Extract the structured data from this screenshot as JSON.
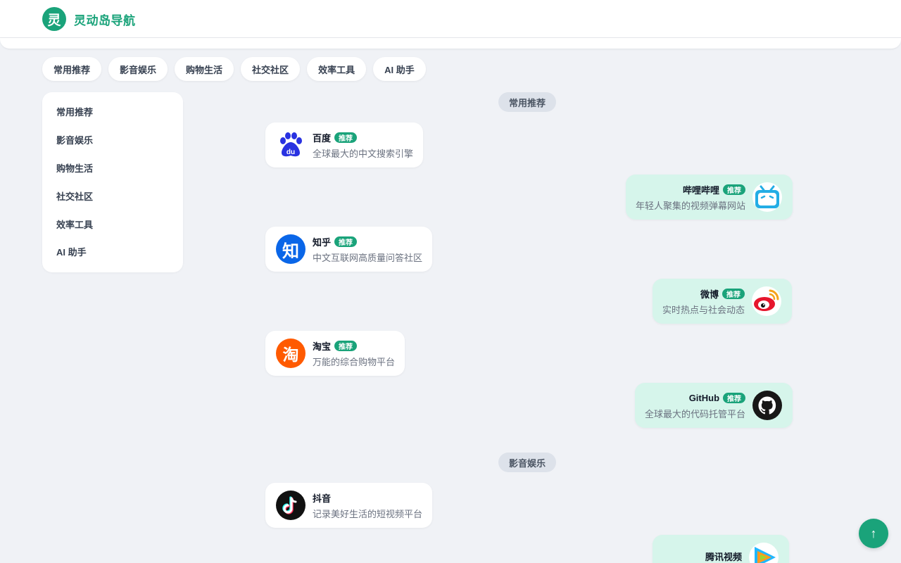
{
  "brand": {
    "logo_char": "灵",
    "title": "灵动岛导航",
    "accent": "#1aa37a"
  },
  "chips": [
    "常用推荐",
    "影音娱乐",
    "购物生活",
    "社交社区",
    "效率工具",
    "AI 助手"
  ],
  "sidebar": [
    "常用推荐",
    "影音娱乐",
    "购物生活",
    "社交社区",
    "效率工具",
    "AI 助手"
  ],
  "sections": [
    {
      "title": "常用推荐",
      "sites": [
        {
          "name": "百度",
          "badge": "推荐",
          "desc": "全球最大的中文搜索引擎",
          "icon": "baidu-paw-icon"
        },
        {
          "name": "哔哩哔哩",
          "badge": "推荐",
          "desc": "年轻人聚集的视频弹幕网站",
          "icon": "bilibili-tv-icon"
        },
        {
          "name": "知乎",
          "badge": "推荐",
          "desc": "中文互联网高质量问答社区",
          "icon": "zhihu-icon"
        },
        {
          "name": "微博",
          "badge": "推荐",
          "desc": "实时热点与社会动态",
          "icon": "weibo-eye-icon"
        },
        {
          "name": "淘宝",
          "badge": "推荐",
          "desc": "万能的综合购物平台",
          "icon": "taobao-icon"
        },
        {
          "name": "GitHub",
          "badge": "推荐",
          "desc": "全球最大的代码托管平台",
          "icon": "github-octocat-icon"
        }
      ]
    },
    {
      "title": "影音娱乐",
      "sites": [
        {
          "name": "抖音",
          "desc": "记录美好生活的短视频平台",
          "icon": "douyin-note-icon"
        },
        {
          "name": "腾讯视频",
          "desc": "",
          "icon": "tencent-video-play-icon"
        }
      ]
    }
  ],
  "back_to_top": "↑",
  "icon_glyphs": {
    "zhihu": "知",
    "taobao": "淘"
  }
}
